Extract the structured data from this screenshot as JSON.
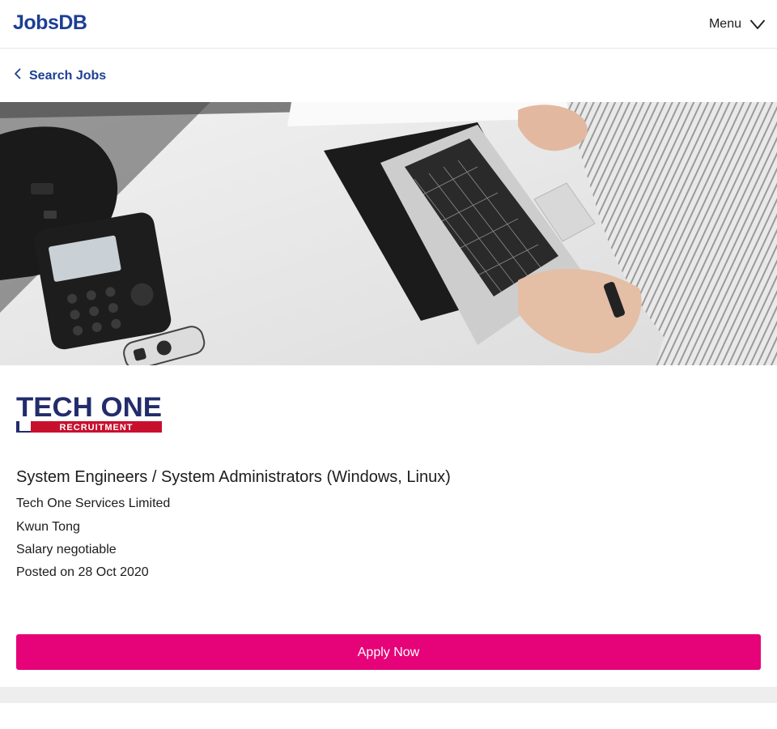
{
  "header": {
    "logo_text": "JobsDB",
    "menu_label": "Menu",
    "menu_icon": "chevron-down-icon"
  },
  "nav": {
    "back_label": "Search Jobs",
    "back_icon": "chevron-left-icon"
  },
  "banner": {
    "description_icon": "office-desk-photo"
  },
  "company_logo": {
    "main_text": "TECH ONE",
    "sub_text": "RECRUITMENT",
    "colors": {
      "navy": "#232c6b",
      "red": "#c8102e"
    }
  },
  "job": {
    "title": "System Engineers / System Administrators (Windows, Linux)",
    "company": "Tech One Services Limited",
    "location": "Kwun Tong",
    "salary": "Salary negotiable",
    "posted": "Posted on 28 Oct 2020"
  },
  "actions": {
    "apply_label": "Apply Now"
  },
  "colors": {
    "brand_blue": "#1c3f94",
    "apply_pink": "#e60278"
  }
}
